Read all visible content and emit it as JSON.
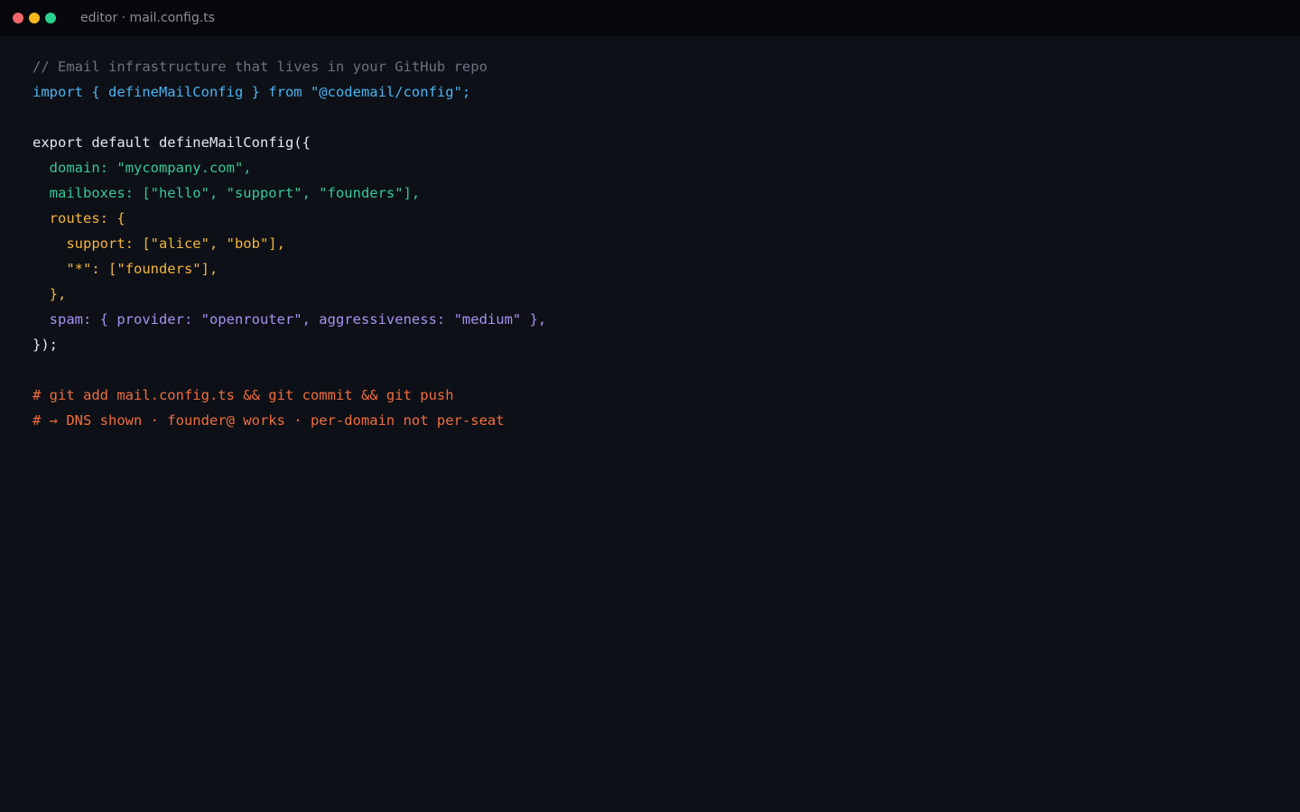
{
  "window": {
    "title": "editor · mail.config.ts",
    "traffic_lights": {
      "close_color": "#f0676b",
      "minimize_color": "#f5bb1d",
      "maximize_color": "#2bd18c"
    }
  },
  "editor": {
    "lines": [
      "// Email infrastructure that lives in your GitHub repo",
      "import { defineMailConfig } from \"@codemail/config\";",
      "",
      "export default defineMailConfig({",
      "  domain: \"mycompany.com\",",
      "  mailboxes: [\"hello\", \"support\", \"founders\"],",
      "  routes: {",
      "    support: [\"alice\", \"bob\"],",
      "    \"*\": [\"founders\"],",
      "  },",
      "  spam: { provider: \"openrouter\", aggressiveness: \"medium\" },",
      "});",
      "",
      "# git add mail.config.ts && git commit && git push",
      "# → DNS shown · founder@ works · per-domain not per-seat"
    ]
  }
}
